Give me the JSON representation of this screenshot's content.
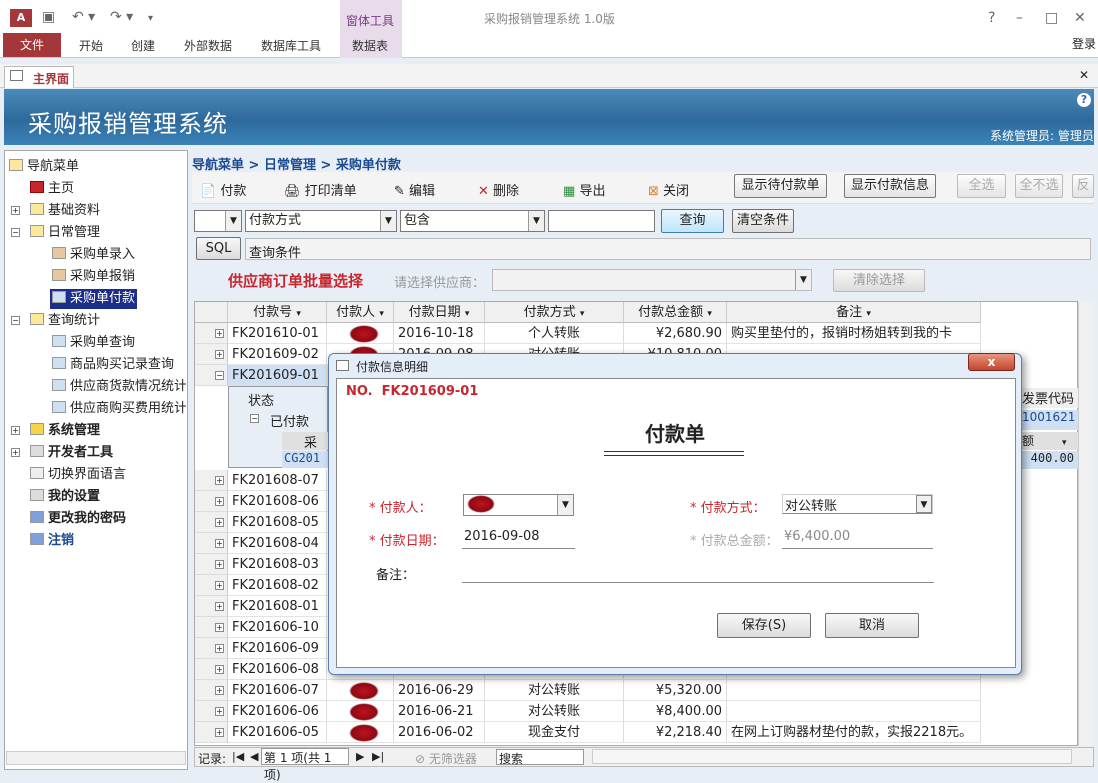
{
  "window": {
    "title": "采购报销管理系统 1.0版",
    "app_icon": "A",
    "login": "登录"
  },
  "ribbon": {
    "context_group": "窗体工具",
    "tabs": [
      "文件",
      "开始",
      "创建",
      "外部数据",
      "数据库工具",
      "数据表"
    ]
  },
  "doc_tab": {
    "label": "主界面"
  },
  "banner": {
    "title": "采购报销管理系统",
    "user": "系统管理员: 管理员"
  },
  "nav": {
    "items": [
      {
        "label": "导航菜单"
      },
      {
        "label": "主页"
      },
      {
        "label": "基础资料"
      },
      {
        "label": "日常管理"
      },
      {
        "label": "采购单录入"
      },
      {
        "label": "采购单报销"
      },
      {
        "label": "采购单付款"
      },
      {
        "label": "查询统计"
      },
      {
        "label": "采购单查询"
      },
      {
        "label": "商品购买记录查询"
      },
      {
        "label": "供应商货款情况统计"
      },
      {
        "label": "供应商购买费用统计"
      },
      {
        "label": "系统管理"
      },
      {
        "label": "开发者工具"
      },
      {
        "label": "切换界面语言"
      },
      {
        "label": "我的设置"
      },
      {
        "label": "更改我的密码"
      },
      {
        "label": "注销"
      }
    ]
  },
  "breadcrumb": "导航菜单 > 日常管理 > 采购单付款",
  "toolbar": {
    "pay": "付款",
    "print": "打印清单",
    "edit": "编辑",
    "delete": "删除",
    "export": "导出",
    "close": "关闭",
    "show_pending": "显示待付款单",
    "show_payinfo": "显示付款信息",
    "select_all": "全选",
    "select_none": "全不选",
    "invert": "反"
  },
  "filter": {
    "field": "付款方式",
    "op": "包含",
    "value": "",
    "query": "查询",
    "clear": "清空条件",
    "sql": "SQL",
    "sql_text": "查询条件"
  },
  "vendor": {
    "label": "供应商订单批量选择",
    "hint": "请选择供应商：",
    "clear": "清除选择"
  },
  "grid": {
    "columns": [
      "付款号",
      "付款人",
      "付款日期",
      "付款方式",
      "付款总金额",
      "备注"
    ],
    "rows": [
      {
        "id": "FK201610-01",
        "date": "2016-10-18",
        "method": "个人转账",
        "amount": "¥2,680.90",
        "note": "购买里垫付的，报销时杨姐转到我的卡"
      },
      {
        "id": "FK201609-02",
        "date": "2016-09-08",
        "method": "对公转账",
        "amount": "¥10,810.00",
        "note": ""
      },
      {
        "id": "FK201609-01",
        "date": "2016-09-08",
        "method": "对公转账",
        "amount": "¥6,400.00",
        "note": ""
      },
      {
        "id": "FK201608-07"
      },
      {
        "id": "FK201608-06"
      },
      {
        "id": "FK201608-05"
      },
      {
        "id": "FK201608-04"
      },
      {
        "id": "FK201608-03"
      },
      {
        "id": "FK201608-02"
      },
      {
        "id": "FK201608-01"
      },
      {
        "id": "FK201606-10"
      },
      {
        "id": "FK201606-09"
      },
      {
        "id": "FK201606-08"
      },
      {
        "id": "FK201606-07",
        "date": "2016-06-29",
        "method": "对公转账",
        "amount": "¥5,320.00",
        "note": ""
      },
      {
        "id": "FK201606-06",
        "date": "2016-06-21",
        "method": "对公转账",
        "amount": "¥8,400.00",
        "note": ""
      },
      {
        "id": "FK201606-05",
        "date": "2016-06-02",
        "method": "现金支付",
        "amount": "¥2,218.40",
        "note": "在网上订购器材垫付的款，实报2218元。"
      }
    ],
    "sub": {
      "status_header": "状态",
      "status_value": "已付款",
      "inner_header": "采购",
      "inner_value": "CG201",
      "right_header": "发票代码",
      "right_value": "1001621",
      "right_col": "额",
      "right_amount": "400.00"
    }
  },
  "statusbar": {
    "record_label": "记录:",
    "position": "第 1 项(共 1 项)",
    "filter": "无筛选器",
    "search": "搜索"
  },
  "dialog": {
    "title": "付款信息明细",
    "close": "x",
    "no_label": "NO.",
    "no_value": "FK201609-01",
    "heading": "付款单",
    "payer_label": "* 付款人：",
    "method_label": "* 付款方式：",
    "method_value": "对公转账",
    "date_label": "* 付款日期：",
    "date_value": "2016-09-08",
    "total_label": "* 付款总金额：",
    "total_value": "¥6,400.00",
    "note_label": "备注：",
    "save": "保存(S)",
    "cancel": "取消"
  }
}
